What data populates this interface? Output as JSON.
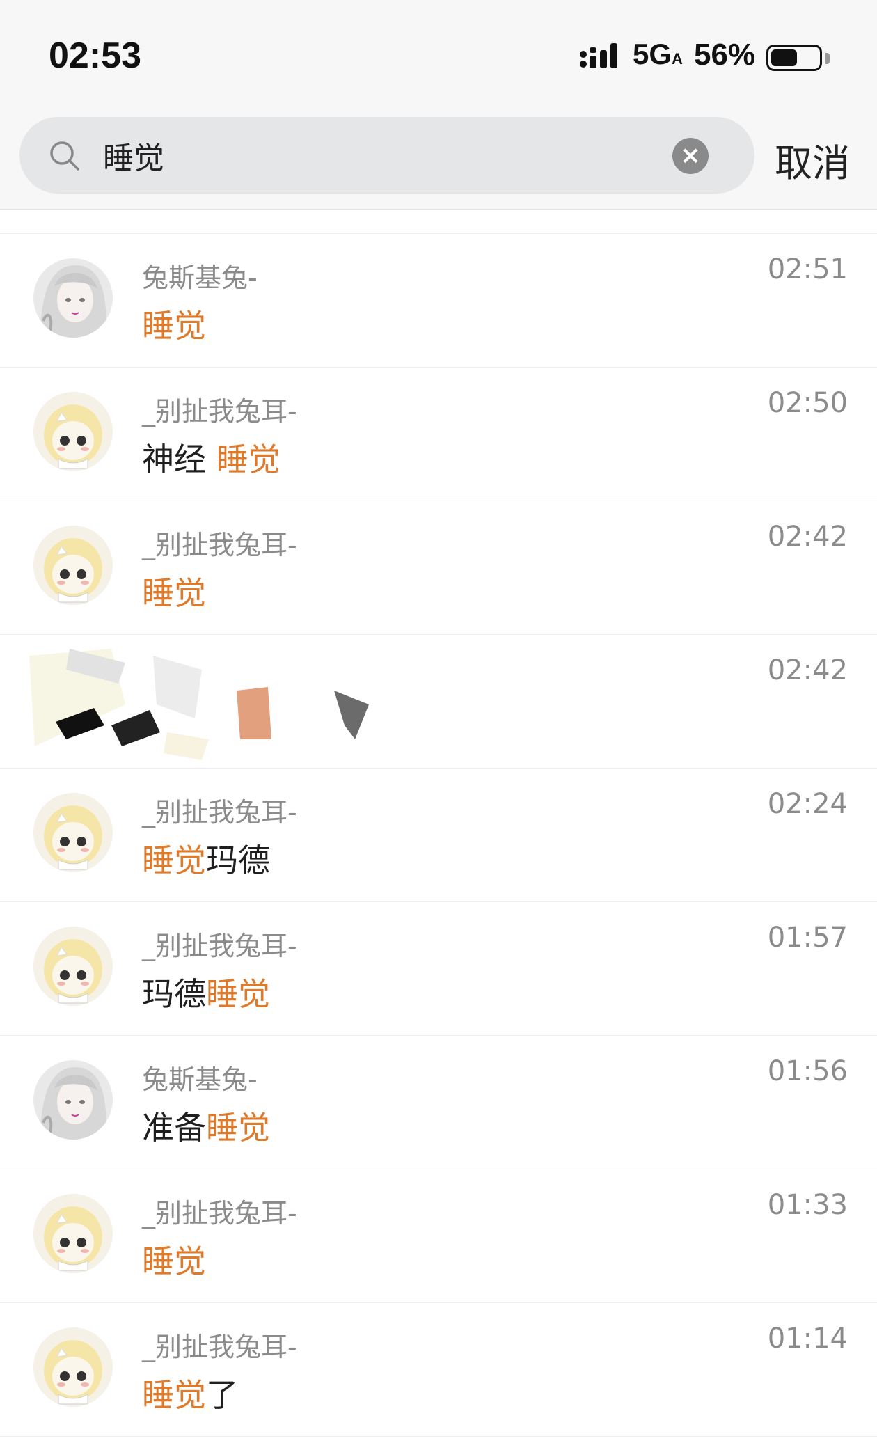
{
  "status_bar": {
    "time": "02:53",
    "network": "5G",
    "network_sub": "A",
    "battery_percent": "56%",
    "battery_level": 0.56
  },
  "search": {
    "query": "睡觉",
    "cancel_label": "取消"
  },
  "colors": {
    "highlight": "#e07a2b",
    "secondary_text": "#8b8b8b"
  },
  "results": [
    {
      "sender": "兔斯基兔-",
      "avatar": "anime-girl-avatar",
      "time": "02:51",
      "message_pre": "",
      "message_hl": "睡觉",
      "message_post": ""
    },
    {
      "sender": "_别扯我兔耳-",
      "avatar": "yellow-chibi-avatar",
      "time": "02:50",
      "message_pre": "神经 ",
      "message_hl": "睡觉",
      "message_post": ""
    },
    {
      "sender": "_别扯我兔耳-",
      "avatar": "yellow-chibi-avatar",
      "time": "02:42",
      "message_pre": "",
      "message_hl": "睡觉",
      "message_post": ""
    },
    {
      "sender": "",
      "avatar": "redacted",
      "time": "02:42",
      "message_pre": "",
      "message_hl": "",
      "message_post": ""
    },
    {
      "sender": "_别扯我兔耳-",
      "avatar": "yellow-chibi-avatar",
      "time": "02:24",
      "message_pre": "",
      "message_hl": "睡觉",
      "message_post": "玛德"
    },
    {
      "sender": "_别扯我兔耳-",
      "avatar": "yellow-chibi-avatar",
      "time": "01:57",
      "message_pre": "玛德",
      "message_hl": "睡觉",
      "message_post": ""
    },
    {
      "sender": "兔斯基兔-",
      "avatar": "anime-girl-avatar",
      "time": "01:56",
      "message_pre": "准备",
      "message_hl": "睡觉",
      "message_post": ""
    },
    {
      "sender": "_别扯我兔耳-",
      "avatar": "yellow-chibi-avatar",
      "time": "01:33",
      "message_pre": "",
      "message_hl": "睡觉",
      "message_post": ""
    },
    {
      "sender": "_别扯我兔耳-",
      "avatar": "yellow-chibi-avatar",
      "time": "01:14",
      "message_pre": "",
      "message_hl": "睡觉",
      "message_post": "了"
    }
  ]
}
